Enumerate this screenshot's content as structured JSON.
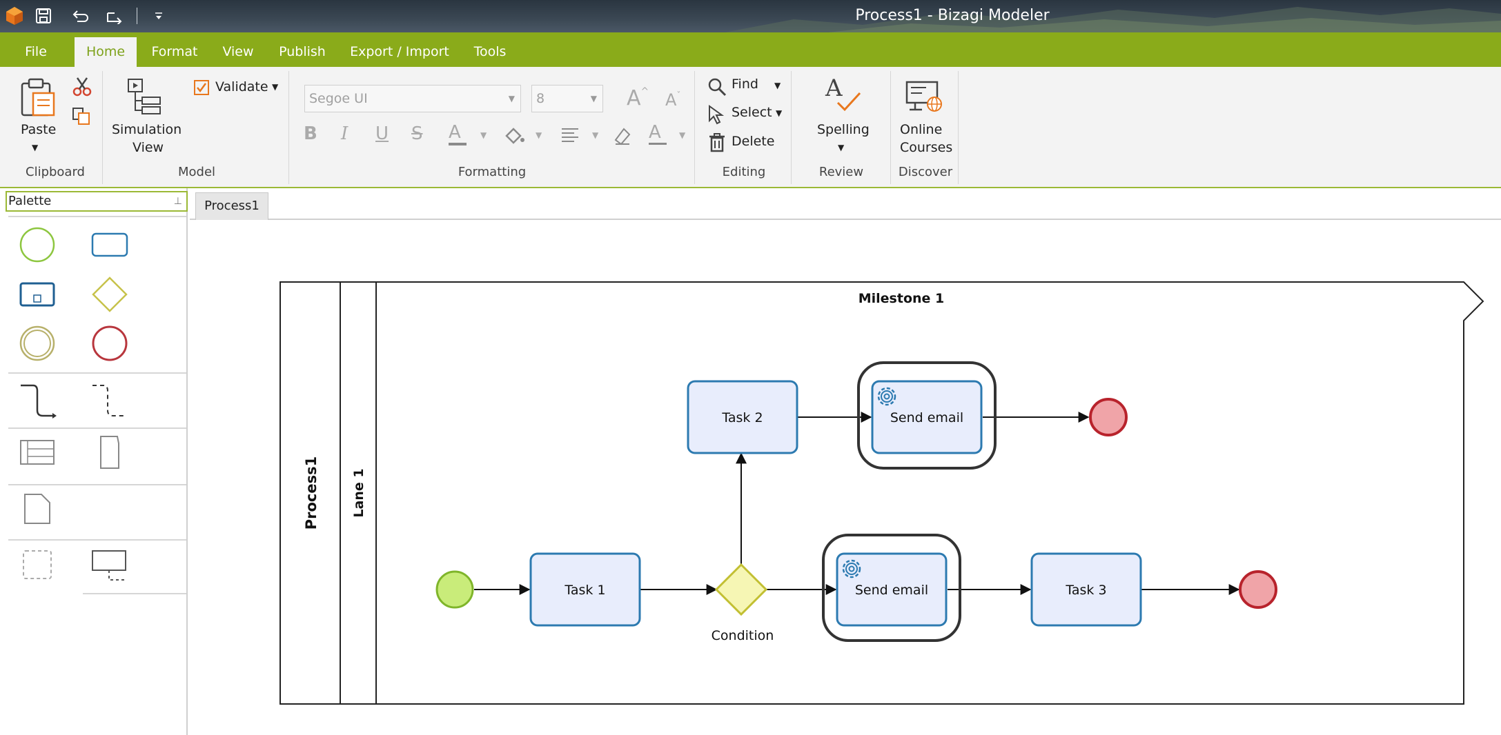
{
  "window": {
    "title": "Process1 - Bizagi Modeler"
  },
  "tabs": [
    "File",
    "Home",
    "Format",
    "View",
    "Publish",
    "Export / Import",
    "Tools"
  ],
  "ribbon": {
    "clipboard": {
      "paste": "Paste",
      "label": "Clipboard"
    },
    "model": {
      "simulation_line1": "Simulation",
      "simulation_line2": "View",
      "validate": "Validate",
      "label": "Model"
    },
    "formatting": {
      "font_placeholder": "Segoe UI",
      "size_placeholder": "8",
      "label": "Formatting"
    },
    "editing": {
      "find": "Find",
      "select": "Select",
      "delete": "Delete",
      "label": "Editing"
    },
    "review": {
      "spelling": "Spelling",
      "label": "Review"
    },
    "discover": {
      "courses_line1": "Online",
      "courses_line2": "Courses",
      "label": "Discover"
    }
  },
  "palette": {
    "title": "Palette"
  },
  "document": {
    "tab": "Process1"
  },
  "diagram": {
    "pool": "Process1",
    "lane": "Lane 1",
    "milestone": "Milestone 1",
    "tasks": [
      "Task 1",
      "Task 2",
      "Task 3"
    ],
    "send_email_top": "Send email",
    "send_email_bottom": "Send email",
    "gateway": "Condition"
  },
  "colors": {
    "accent": "#8aab1a",
    "task_fill": "#e8edfc",
    "task_stroke": "#2c7ab0",
    "start": "#c9ec7a",
    "end": "#f0a4a8",
    "gateway": "#f6f6b4"
  }
}
